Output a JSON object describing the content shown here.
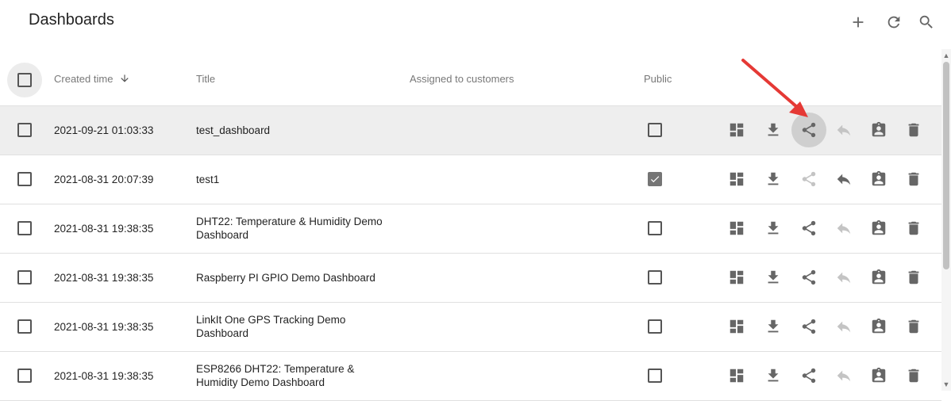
{
  "header": {
    "title": "Dashboards"
  },
  "columns": {
    "created_time": "Created time",
    "title": "Title",
    "assigned": "Assigned to customers",
    "public": "Public"
  },
  "rows": [
    {
      "time": "2021-09-21 01:03:33",
      "title": "test_dashboard",
      "public": false,
      "share_enabled": true,
      "unshare_enabled": false
    },
    {
      "time": "2021-08-31 20:07:39",
      "title": "test1",
      "public": true,
      "share_enabled": false,
      "unshare_enabled": true
    },
    {
      "time": "2021-08-31 19:38:35",
      "title": "DHT22: Temperature & Humidity Demo Dashboard",
      "public": false,
      "share_enabled": true,
      "unshare_enabled": false
    },
    {
      "time": "2021-08-31 19:38:35",
      "title": "Raspberry PI GPIO Demo Dashboard",
      "public": false,
      "share_enabled": true,
      "unshare_enabled": false
    },
    {
      "time": "2021-08-31 19:38:35",
      "title": "LinkIt One GPS Tracking Demo Dashboard",
      "public": false,
      "share_enabled": true,
      "unshare_enabled": false
    },
    {
      "time": "2021-08-31 19:38:35",
      "title": "ESP8266 DHT22: Temperature & Humidity Demo Dashboard",
      "public": false,
      "share_enabled": true,
      "unshare_enabled": false
    }
  ],
  "icons": {
    "header": [
      "plus-icon",
      "refresh-icon",
      "search-icon"
    ],
    "row_actions": [
      "dashboard-icon",
      "download-icon",
      "share-icon",
      "reply-icon",
      "assignment-icon",
      "delete-icon"
    ],
    "annotation": "red-arrow"
  },
  "colors": {
    "icon": "#666666",
    "icon_disabled": "#c4c4c4",
    "highlight_row": "#eeeeee",
    "annotation": "#e53935"
  }
}
